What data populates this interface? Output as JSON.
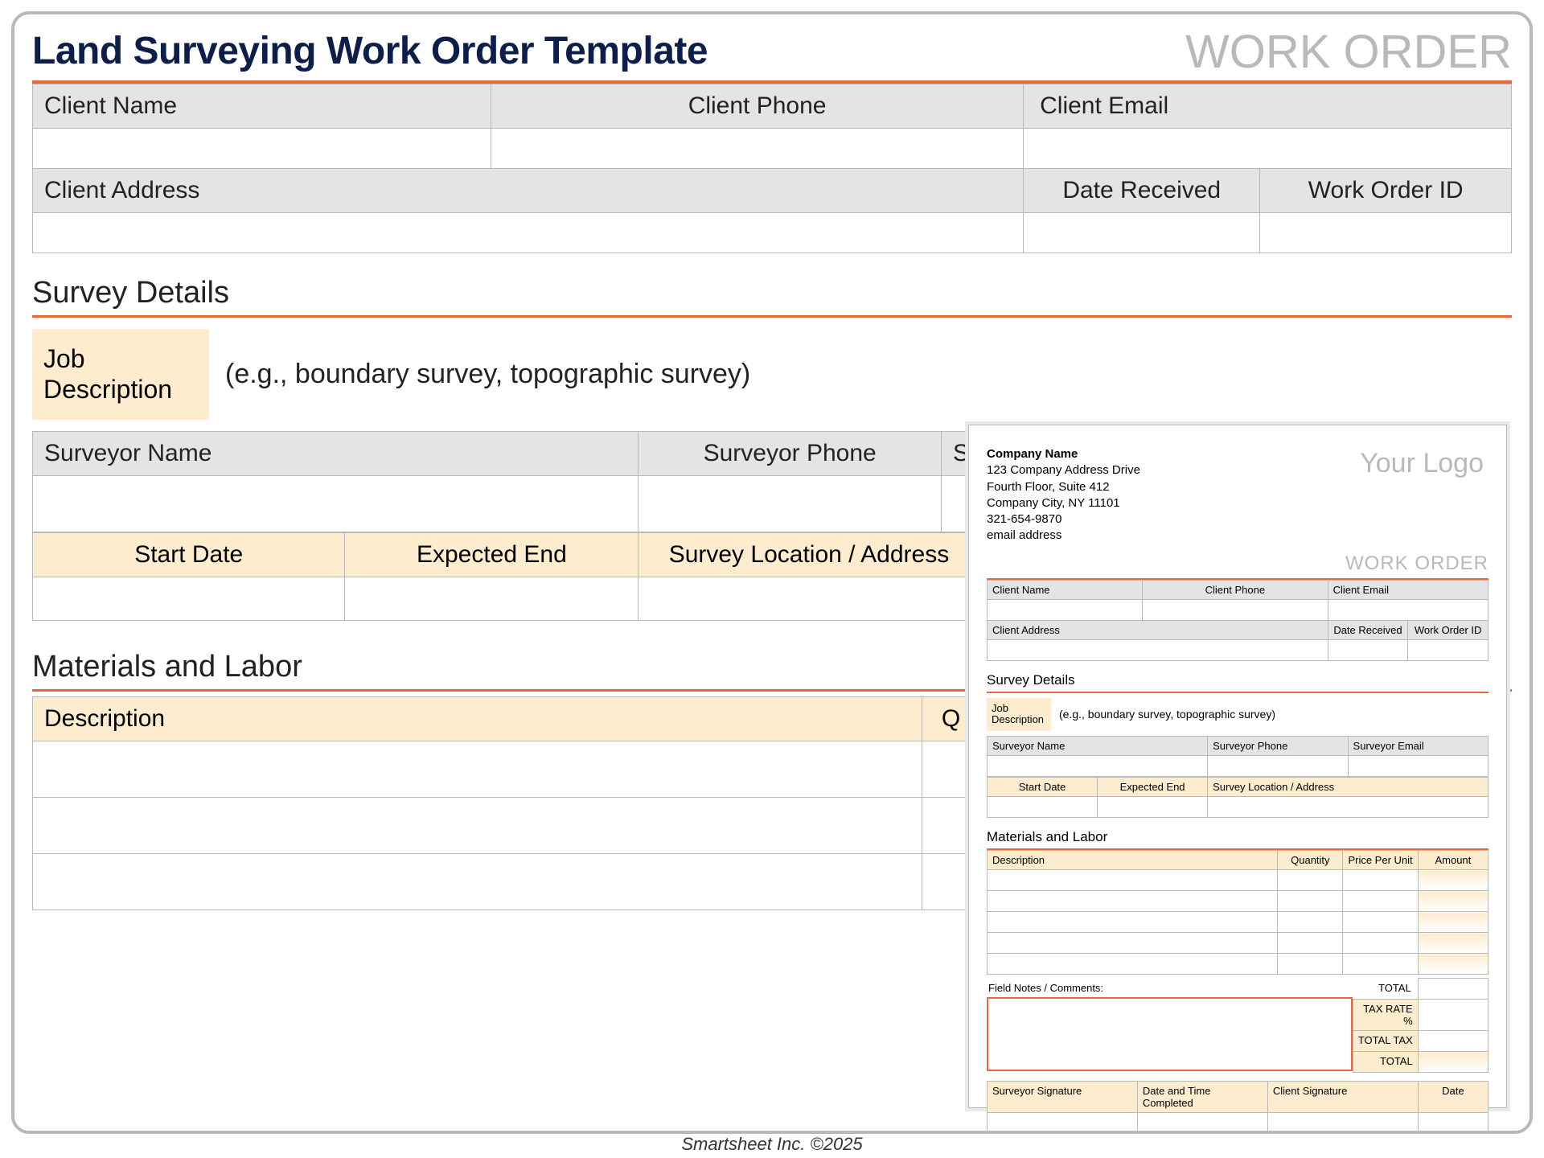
{
  "header": {
    "title": "Land Surveying Work Order Template",
    "brand": "WORK ORDER"
  },
  "client_section": {
    "name_label": "Client Name",
    "phone_label": "Client Phone",
    "email_label": "Client Email",
    "address_label": "Client Address",
    "date_received_label": "Date Received",
    "work_order_id_label": "Work Order ID"
  },
  "survey": {
    "section_title": "Survey Details",
    "job_desc_label": "Job Description",
    "job_desc_hint": "(e.g., boundary survey, topographic survey)",
    "surveyor_name_label": "Surveyor Name",
    "surveyor_phone_label": "Surveyor Phone",
    "surveyor_s_label": "S",
    "surveyor_email_label": "Surveyor Email",
    "start_date_label": "Start Date",
    "expected_end_label": "Expected End",
    "location_label": "Survey Location / Address"
  },
  "materials": {
    "section_title": "Materials and Labor",
    "description_label": "Description",
    "q_label": "Q",
    "quantity_label": "Quantity",
    "price_label": "Price Per Unit",
    "amount_label": "Amount"
  },
  "totals": {
    "total_label": "TOTAL",
    "tax_rate_label": "TAX RATE %",
    "total_tax_label": "TOTAL TAX",
    "grand_total_label": "TOTAL"
  },
  "notes": {
    "label": "Field Notes / Comments:"
  },
  "sign": {
    "surveyor_sig_label": "Surveyor Signature",
    "date_time_label": "Date and Time Completed",
    "client_sig_label": "Client Signature",
    "date_label": "Date"
  },
  "thumbnail": {
    "company_name": "Company Name",
    "addr1": "123 Company Address Drive",
    "addr2": "Fourth Floor, Suite 412",
    "addr3": "Company City, NY  11101",
    "phone": "321-654-9870",
    "email": "email address",
    "logo": "Your Logo",
    "work_order": "WORK ORDER"
  },
  "footer": "Smartsheet Inc. ©2025"
}
